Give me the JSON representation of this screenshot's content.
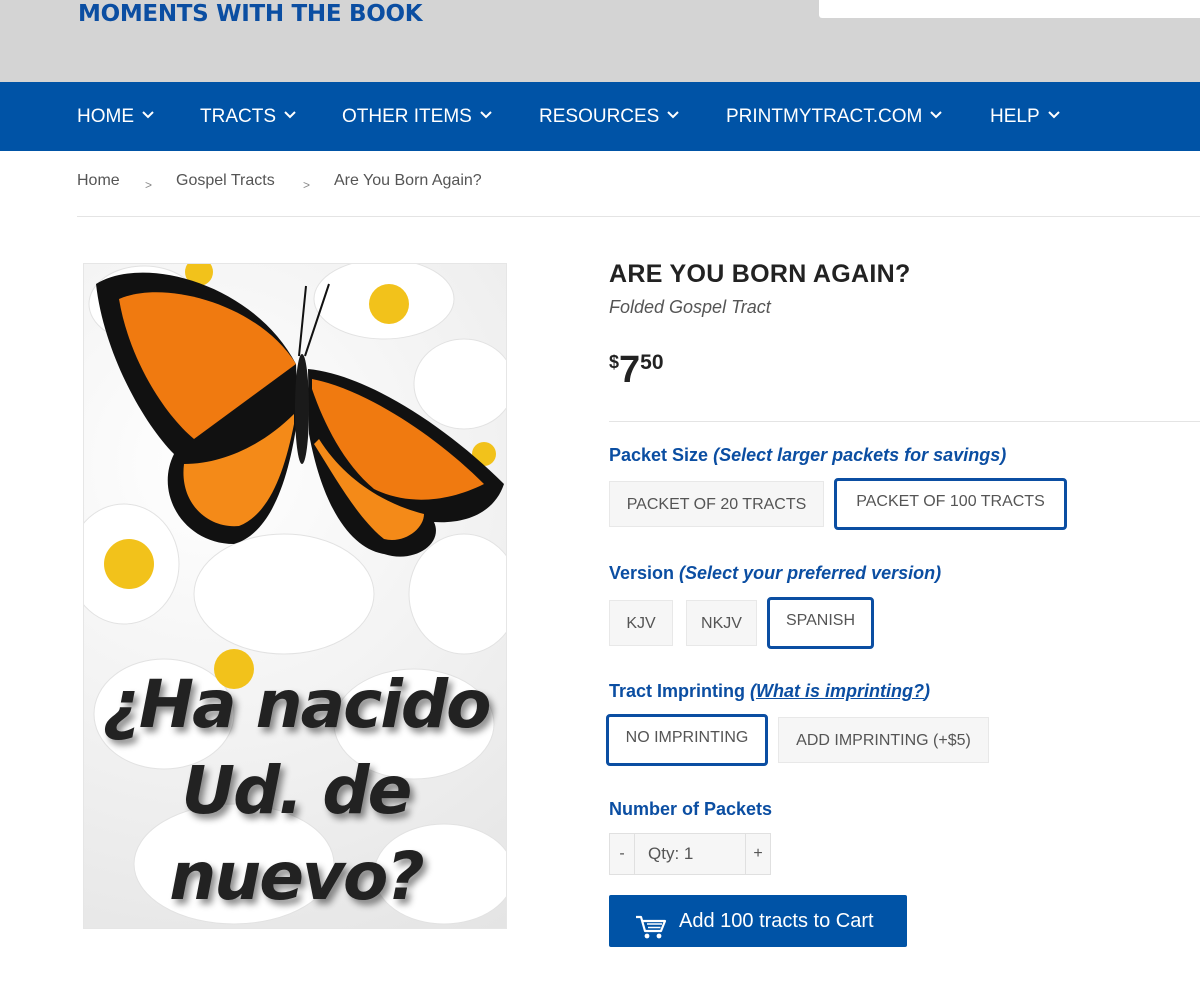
{
  "header": {
    "logo_text": "MOMENTS WITH THE BOOK"
  },
  "nav": {
    "items": [
      {
        "label": "HOME"
      },
      {
        "label": "TRACTS"
      },
      {
        "label": "OTHER ITEMS"
      },
      {
        "label": "RESOURCES"
      },
      {
        "label": "PRINTMYTRACT.COM"
      },
      {
        "label": "HELP"
      }
    ]
  },
  "breadcrumb": {
    "items": [
      "Home",
      "Gospel Tracts",
      "Are You Born Again?"
    ],
    "separator": ">"
  },
  "product": {
    "cover_text": "¿Ha nacido Ud. de nuevo?",
    "title": "ARE YOU BORN AGAIN?",
    "subtitle": "Folded Gospel Tract",
    "price": {
      "currency": "$",
      "whole": "7",
      "cents": "50"
    }
  },
  "options": {
    "packet_size": {
      "label": "Packet Size",
      "hint": "(Select larger packets for savings)",
      "choices": [
        "PACKET OF 20 TRACTS",
        "PACKET OF 100 TRACTS"
      ],
      "selected": "PACKET OF 100 TRACTS"
    },
    "version": {
      "label": "Version",
      "hint": "(Select your preferred version)",
      "choices": [
        "KJV",
        "NKJV",
        "SPANISH"
      ],
      "selected": "SPANISH"
    },
    "imprinting": {
      "label": "Tract Imprinting",
      "hint_open": "(",
      "hint_link": "What is imprinting?",
      "hint_close": ")",
      "choices": [
        "NO IMPRINTING",
        "ADD IMPRINTING (+$5)"
      ],
      "selected": "NO IMPRINTING"
    },
    "quantity": {
      "label": "Number of Packets",
      "minus": "-",
      "plus": "+",
      "value": "Qty: 1"
    }
  },
  "cart": {
    "button_label": "Add 100 tracts to Cart",
    "icon": "cart-icon"
  },
  "colors": {
    "brand_blue": "#0053a6",
    "label_blue": "#0b4ea2",
    "header_gray": "#d4d4d4"
  }
}
